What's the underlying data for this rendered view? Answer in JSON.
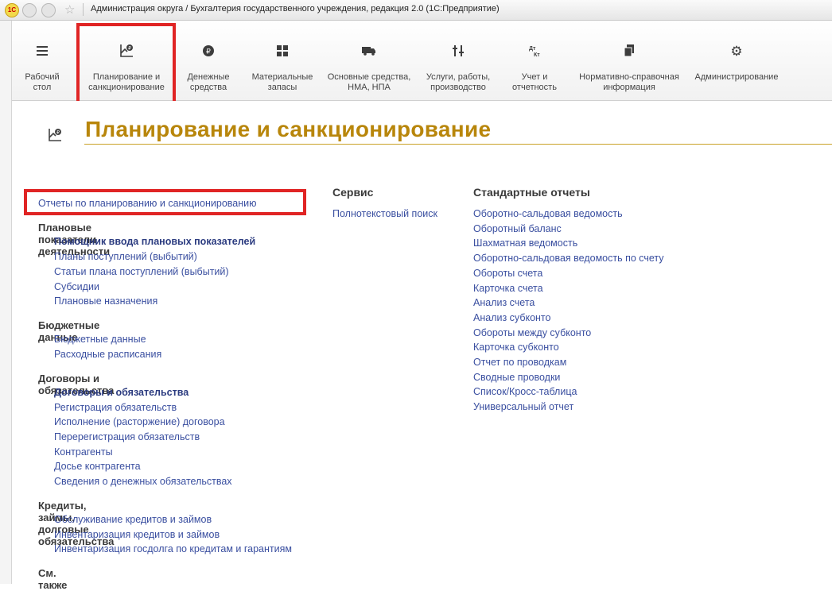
{
  "window": {
    "title": "Администрация округа / Бухгалтерия государственного учреждения, редакция 2.0  (1С:Предприятие)",
    "logo_text": "1С",
    "icons": [
      "app-logo-icon",
      "back-icon",
      "forward-icon",
      "star-icon"
    ]
  },
  "sections": [
    {
      "label": "Рабочий\nстол",
      "icon": "menu-icon"
    },
    {
      "label": "Планирование и\nсанкционирование",
      "icon": "planning-icon",
      "active": true
    },
    {
      "label": "Денежные\nсредства",
      "icon": "money-icon"
    },
    {
      "label": "Материальные\nзапасы",
      "icon": "grid-icon"
    },
    {
      "label": "Основные средства,\nНМА, НПА",
      "icon": "truck-icon"
    },
    {
      "label": "Услуги, работы,\nпроизводство",
      "icon": "tools-icon"
    },
    {
      "label": "Учет и\nотчетность",
      "icon": "debit-credit-icon"
    },
    {
      "label": "Нормативно-справочная\nинформация",
      "icon": "documents-icon"
    },
    {
      "label": "Администрирование",
      "icon": "gear-icon"
    }
  ],
  "page": {
    "title": "Планирование и санкционирование"
  },
  "left_column": {
    "reports_link": "Отчеты по планированию и санкционированию",
    "groups": [
      {
        "header": "Плановые показатели деятельности",
        "items": [
          {
            "text": "Помощник ввода плановых показателей",
            "bold": true
          },
          {
            "text": "Планы поступлений (выбытий)"
          },
          {
            "text": "Статьи плана поступлений (выбытий)"
          },
          {
            "text": "Субсидии"
          },
          {
            "text": "Плановые назначения"
          }
        ]
      },
      {
        "header": "Бюджетные данные",
        "items": [
          {
            "text": "Бюджетные данные"
          },
          {
            "text": "Расходные расписания"
          }
        ]
      },
      {
        "header": "Договоры и обязательства",
        "items": [
          {
            "text": "Договоры и обязательства",
            "bold": true
          },
          {
            "text": "Регистрация обязательств"
          },
          {
            "text": "Исполнение (расторжение) договора"
          },
          {
            "text": "Перерегистрация обязательств"
          },
          {
            "text": "Контрагенты"
          },
          {
            "text": "Досье контрагента"
          },
          {
            "text": "Сведения о денежных обязательствах"
          }
        ]
      },
      {
        "header": "Кредиты, займы, долговые обязательства",
        "items": [
          {
            "text": "Обслуживание кредитов и займов"
          },
          {
            "text": "Инвентаризация кредитов и займов"
          },
          {
            "text": "Инвентаризация госдолга по кредитам и гарантиям"
          }
        ]
      },
      {
        "header": "См. также",
        "items": []
      }
    ]
  },
  "service": {
    "header": "Сервис",
    "items": [
      "Полнотекстовый поиск"
    ]
  },
  "reports": {
    "header": "Стандартные отчеты",
    "items": [
      "Оборотно-сальдовая ведомость",
      "Оборотный баланс",
      "Шахматная ведомость",
      "Оборотно-сальдовая ведомость по счету",
      "Обороты счета",
      "Карточка счета",
      "Анализ счета",
      "Анализ субконто",
      "Обороты между субконто",
      "Карточка субконто",
      "Отчет по проводкам",
      "Сводные проводки",
      "Список/Кросс-таблица",
      "Универсальный отчет"
    ]
  },
  "colors": {
    "title": "#b8860b",
    "link": "#3a4fa0",
    "highlight": "#e02424"
  }
}
